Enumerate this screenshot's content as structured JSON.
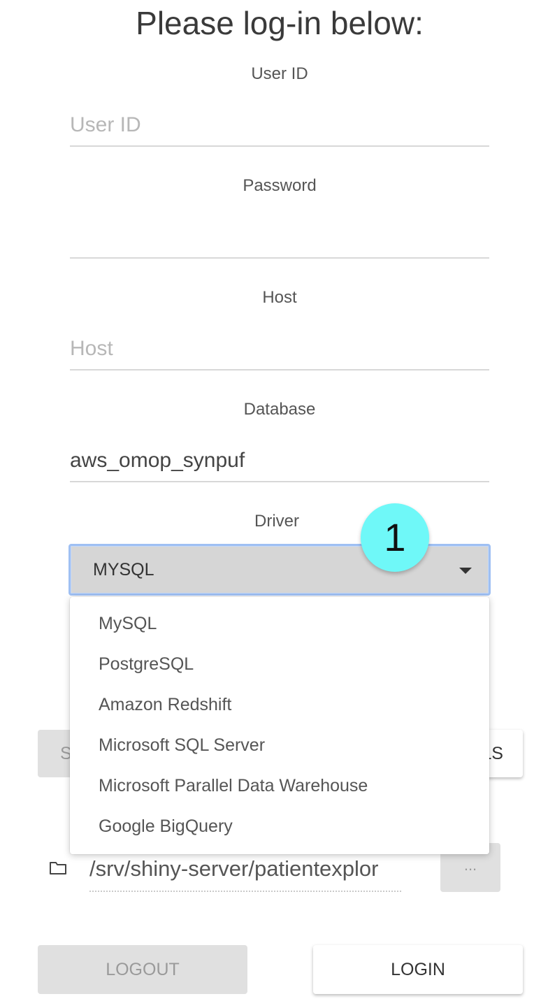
{
  "title": "Please log-in below:",
  "fields": {
    "user_id": {
      "label": "User ID",
      "placeholder": "User ID",
      "value": ""
    },
    "password": {
      "label": "Password",
      "placeholder": "",
      "value": ""
    },
    "host": {
      "label": "Host",
      "placeholder": "Host",
      "value": ""
    },
    "database": {
      "label": "Database",
      "placeholder": "",
      "value": "aws_omop_synpuf"
    }
  },
  "driver": {
    "label": "Driver",
    "selected": "MYSQL",
    "options": [
      "MySQL",
      "PostgreSQL",
      "Amazon Redshift",
      "Microsoft SQL Server",
      "Microsoft Parallel Data Warehouse",
      "Google BigQuery"
    ]
  },
  "annotation_badge": "1",
  "hidden_buttons": {
    "left_partial_label": "S",
    "right_partial_label": "LS"
  },
  "path": {
    "value": "/srv/shiny-server/patientexplor",
    "browse_label": "..."
  },
  "actions": {
    "logout_label": "LOGOUT",
    "login_label": "LOGIN"
  },
  "icons": {
    "folder": "folder-icon",
    "caret": "caret-down-icon"
  },
  "colors": {
    "badge": "#6ff8f8",
    "select_focus_border": "#9fc0f3",
    "disabled_button": "#e0e0e0"
  }
}
